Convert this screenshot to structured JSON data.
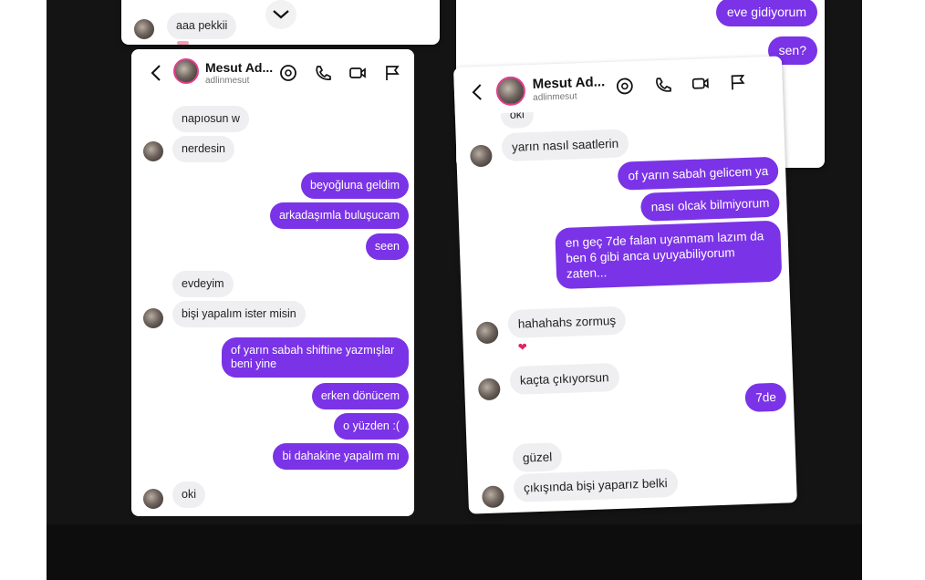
{
  "header": {
    "name": "Mesut Ad...",
    "username": "adlinmesut"
  },
  "top_left": {
    "incoming": "aaa pekkii"
  },
  "top_right": {
    "outgoing": [
      "eve gidiyorum",
      "sen?"
    ]
  },
  "left_chat": {
    "messages": [
      {
        "dir": "in",
        "text": "napıosun w"
      },
      {
        "dir": "in",
        "text": "nerdesin"
      },
      {
        "dir": "out",
        "text": "beyoğluna geldim"
      },
      {
        "dir": "out",
        "text": "arkadaşımla buluşucam"
      },
      {
        "dir": "out",
        "text": "seen"
      },
      {
        "dir": "in",
        "text": "evdeyim"
      },
      {
        "dir": "in",
        "text": "bişi yapalım ister misin"
      },
      {
        "dir": "out",
        "text": "of yarın sabah shiftine yazmışlar beni yine"
      },
      {
        "dir": "out",
        "text": "erken dönücem"
      },
      {
        "dir": "out",
        "text": "o yüzden :("
      },
      {
        "dir": "out",
        "text": "bi dahakine yapalım mı"
      },
      {
        "dir": "in",
        "text": "oki"
      }
    ]
  },
  "right_chat": {
    "messages": [
      {
        "dir": "in",
        "text": "oki"
      },
      {
        "dir": "in",
        "text": "yarın nasıl saatlerin"
      },
      {
        "dir": "out",
        "text": "of yarın sabah gelicem ya"
      },
      {
        "dir": "out",
        "text": "nası olcak bilmiyorum"
      },
      {
        "dir": "out",
        "text": "en geç 7de falan uyanmam lazım da ben 6 gibi anca uyuyabiliyorum zaten..."
      },
      {
        "dir": "in",
        "text": "hahahahs zormuş"
      },
      {
        "dir": "in",
        "text": "kaçta çıkıyorsun"
      },
      {
        "dir": "out",
        "text": "7de"
      },
      {
        "dir": "in",
        "text": "güzel"
      },
      {
        "dir": "in",
        "text": "çıkışında bişi yaparız belki"
      }
    ],
    "reaction": "❤"
  },
  "colors": {
    "outgoing": "#7a33e6",
    "incoming": "#efeff1",
    "backdrop": "#141414"
  },
  "icons": [
    "back-arrow-icon",
    "effects-icon",
    "phone-icon",
    "video-icon",
    "flag-icon",
    "chevron-down-icon",
    "heart-icon"
  ]
}
